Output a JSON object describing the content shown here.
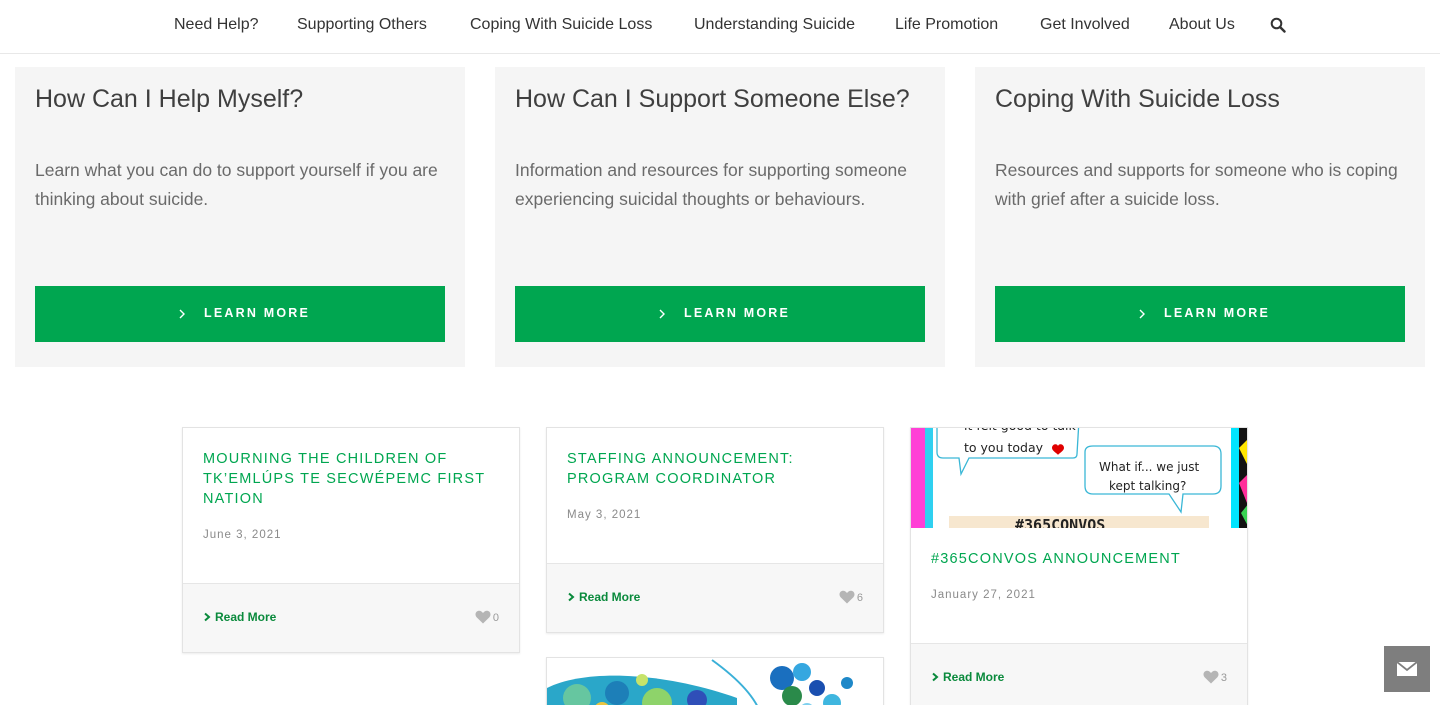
{
  "nav": {
    "items": [
      "Need Help?",
      "Supporting Others",
      "Coping With Suicide Loss",
      "Understanding Suicide",
      "Life Promotion",
      "Get Involved",
      "About Us"
    ]
  },
  "cards": [
    {
      "title": "How Can I Help Myself?",
      "text": "Learn what you can do to support yourself if you are thinking about suicide.",
      "button": "LEARN MORE"
    },
    {
      "title": "How Can I Support Someone Else?",
      "text": "Information and resources for supporting someone experiencing suicidal thoughts or behaviours.",
      "button": "LEARN MORE"
    },
    {
      "title": "Coping With Suicide Loss",
      "text": "Resources and supports for someone who is coping with grief after a suicide loss.",
      "button": "LEARN MORE"
    }
  ],
  "posts": [
    {
      "title": "MOURNING THE CHILDREN OF TK’EMLÚPS TE SECWÉPEMC FIRST NATION",
      "date": "June 3, 2021",
      "read_more": "Read More",
      "likes": "0"
    },
    {
      "title": "STAFFING ANNOUNCEMENT: PROGRAM COORDINATOR",
      "date": "May 3, 2021",
      "read_more": "Read More",
      "likes": "6"
    },
    {
      "title": "#365CONVOS ANNOUNCEMENT",
      "date": "January 27, 2021",
      "read_more": "Read More",
      "likes": "3",
      "image_text": {
        "bubble1": "to you today",
        "bubble2_line1": "What if... we just",
        "bubble2_line2": "kept talking?",
        "banner": "#365CONVOS"
      }
    }
  ],
  "colors": {
    "accent": "#00a650",
    "card_bg": "#f5f5f5"
  }
}
